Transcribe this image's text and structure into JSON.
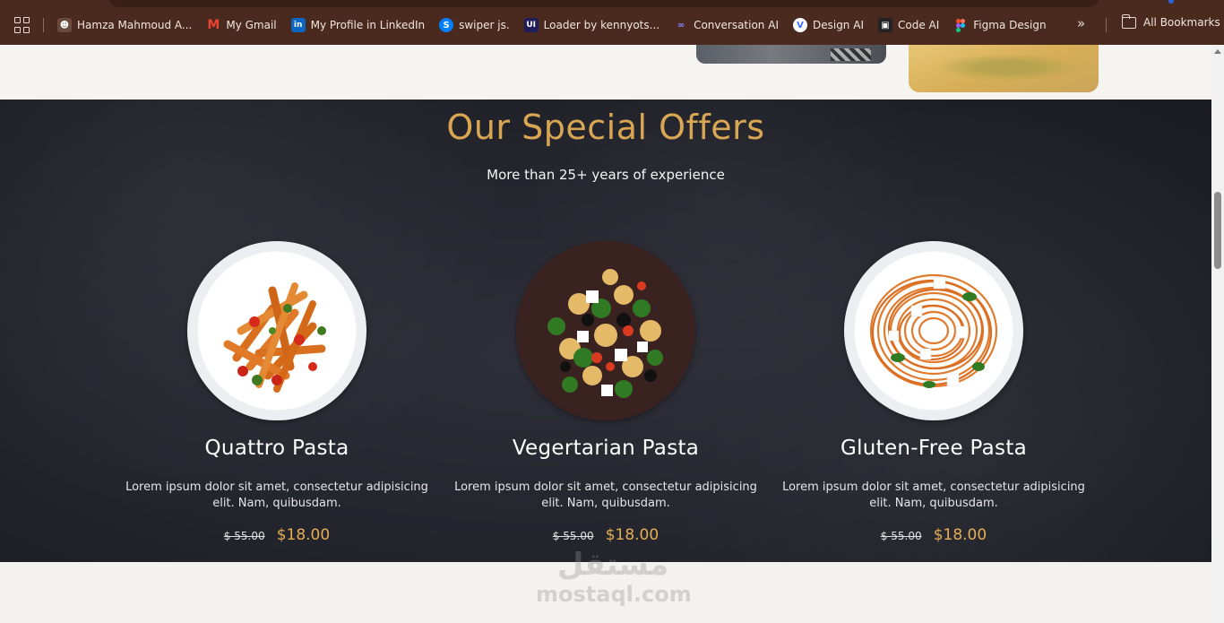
{
  "bookmarks": {
    "items": [
      {
        "label": "Hamza Mahmoud A...",
        "icon": "person-avatar-icon",
        "color": "#6a4a3a"
      },
      {
        "label": "My Gmail",
        "icon": "gmail-icon",
        "color": "#ea4335"
      },
      {
        "label": "My Profile in LinkedIn",
        "icon": "linkedin-icon",
        "color": "#0a66c2"
      },
      {
        "label": "swiper js.",
        "icon": "swiper-icon",
        "color": "#0080ff"
      },
      {
        "label": "Loader by kennyots...",
        "icon": "uiverse-icon",
        "color": "#1e1e5a"
      },
      {
        "label": "Conversation AI",
        "icon": "conversation-ai-icon",
        "color": "#6c63ff"
      },
      {
        "label": "Design AI",
        "icon": "design-ai-icon",
        "color": "#3d6bff"
      },
      {
        "label": "Code AI",
        "icon": "code-ai-icon",
        "color": "#222222"
      },
      {
        "label": "Figma Design",
        "icon": "figma-icon",
        "color": "#f24e1e"
      }
    ],
    "all_bookmarks_label": "All Bookmarks",
    "more_icon": "chevron-double-right-icon"
  },
  "offers": {
    "title": "Our Special Offers",
    "subtitle": "More than 25+ years of experience",
    "cards": [
      {
        "name": "Quattro Pasta",
        "description": "Lorem ipsum dolor sit amet, consectetur adipisicing elit. Nam, quibusdam.",
        "old_price": "$ 55.00",
        "new_price": "$18.00"
      },
      {
        "name": "Vegertarian Pasta",
        "description": "Lorem ipsum dolor sit amet, consectetur adipisicing elit. Nam, quibusdam.",
        "old_price": "$ 55.00",
        "new_price": "$18.00"
      },
      {
        "name": "Gluten-Free Pasta",
        "description": "Lorem ipsum dolor sit amet, consectetur adipisicing elit. Nam, quibusdam.",
        "old_price": "$ 55.00",
        "new_price": "$18.00"
      }
    ]
  },
  "watermark": {
    "arabic": "مستقل",
    "latin": "mostaql.com"
  },
  "colors": {
    "accent": "#d9a753",
    "price": "#e6ad55",
    "section_bg": "#23242c",
    "bookmarks_bar": "#4a2a1e"
  }
}
